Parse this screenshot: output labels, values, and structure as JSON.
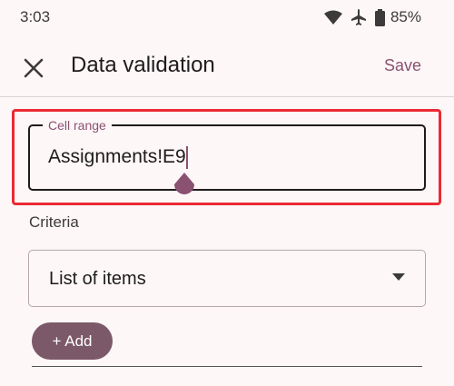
{
  "status_bar": {
    "time": "3:03",
    "battery": "85%",
    "icons": [
      "wifi-icon",
      "airplane-icon",
      "battery-icon"
    ]
  },
  "app_bar": {
    "title": "Data validation",
    "close_icon": "close-icon",
    "save_label": "Save"
  },
  "cell_range": {
    "label": "Cell range",
    "value": "Assignments!E9"
  },
  "criteria": {
    "label": "Criteria",
    "selected": "List of items"
  },
  "add_button": {
    "label": "+ Add"
  },
  "colors": {
    "accent": "#8a5170",
    "highlight": "#ec2a34",
    "add_button_bg": "#7c5968",
    "background": "#fdf7f7"
  }
}
